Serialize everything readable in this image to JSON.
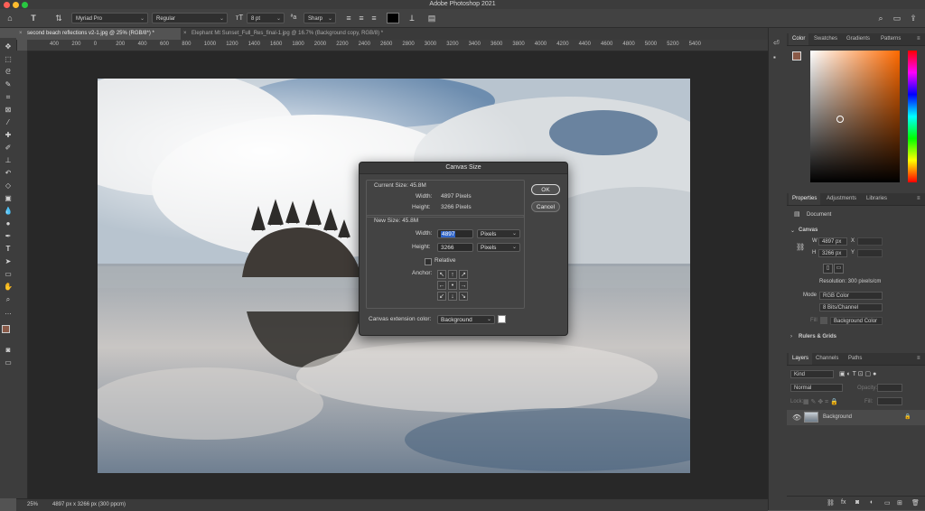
{
  "app": {
    "title": "Adobe Photoshop 2021"
  },
  "options_bar": {
    "tool_glyph": "T",
    "font_family": "Myriad Pro",
    "font_style": "Regular",
    "font_size": "8 pt",
    "anti_alias": "Sharp",
    "text_color": "#000000"
  },
  "tabs": [
    {
      "label": "second beach reflections v2-1.jpg @ 25% (RGB/8*) *"
    },
    {
      "label": "Elephant Mt Sunset_Full_Res_final-1.jpg @ 16.7% (Background copy, RGB/8) *"
    }
  ],
  "ruler": {
    "ticks": [
      "400",
      "200",
      "0",
      "200",
      "400",
      "600",
      "800",
      "1000",
      "1200",
      "1400",
      "1600",
      "1800",
      "2000",
      "2200",
      "2400",
      "2600",
      "2800",
      "3000",
      "3200",
      "3400",
      "3600",
      "3800",
      "4000",
      "4200",
      "4400",
      "4600",
      "4800",
      "5000",
      "5200",
      "5400"
    ]
  },
  "status": {
    "zoom": "25%",
    "doc_info": "4897 px x 3266 px (300 ppcm)"
  },
  "color_panel": {
    "tabs": [
      "Color",
      "Swatches",
      "Gradients",
      "Patterns"
    ],
    "foreground": "#8a5a48",
    "background": "#ffffff"
  },
  "properties_panel": {
    "tabs": [
      "Properties",
      "Adjustments",
      "Libraries"
    ],
    "document_label": "Document",
    "section": "Canvas",
    "w_label": "W",
    "w_value": "4897 px",
    "h_label": "H",
    "h_value": "3266 px",
    "x_label": "X",
    "y_label": "Y",
    "resolution": "Resolution: 300 pixels/cm",
    "mode_label": "Mode",
    "mode_value": "RGB Color",
    "bits_value": "8 Bits/Channel",
    "fill_label": "Fill",
    "fill_value": "Background Color",
    "next_section": "Rulers & Grids"
  },
  "layers_panel": {
    "tabs": [
      "Layers",
      "Channels",
      "Paths"
    ],
    "filter_placeholder": "Kind",
    "blend_mode": "Normal",
    "opacity_label": "Opacity:",
    "lock_label": "Lock:",
    "fill_label": "Fill:",
    "layers": [
      {
        "name": "Background"
      }
    ]
  },
  "dialog": {
    "title": "Canvas Size",
    "current_size": "Current Size: 45.8M",
    "current_width_label": "Width:",
    "current_width_value": "4897 Pixels",
    "current_height_label": "Height:",
    "current_height_value": "3266 Pixels",
    "new_size": "New Size: 45.8M",
    "new_width_label": "Width:",
    "new_width_value": "4897",
    "new_width_unit": "Pixels",
    "new_height_label": "Height:",
    "new_height_value": "3266",
    "new_height_unit": "Pixels",
    "relative_label": "Relative",
    "anchor_label": "Anchor:",
    "anchor_glyphs": [
      "↖",
      "↑",
      "↗",
      "←",
      "•",
      "→",
      "↙",
      "↓",
      "↘"
    ],
    "extension_label": "Canvas extension color:",
    "extension_value": "Background",
    "extension_swatch": "#ffffff",
    "ok_label": "OK",
    "cancel_label": "Cancel"
  }
}
